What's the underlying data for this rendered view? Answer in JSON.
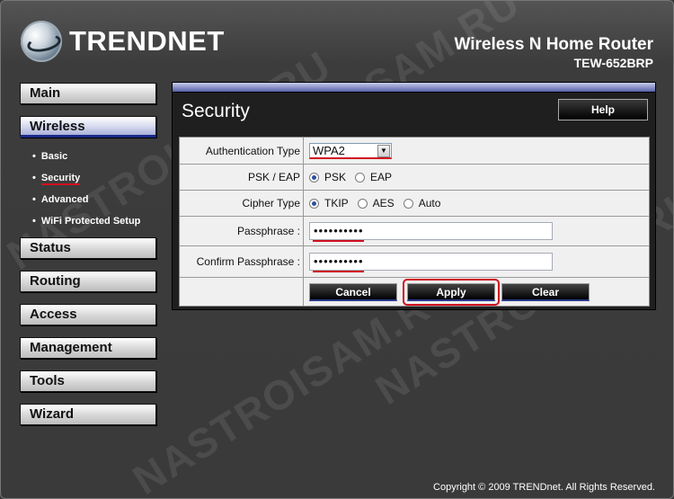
{
  "header": {
    "logo_text": "TRENDNET",
    "product_name": "Wireless N Home Router",
    "model": "TEW-652BRP"
  },
  "nav": {
    "items": [
      {
        "label": "Main"
      },
      {
        "label": "Wireless"
      },
      {
        "label": "Status"
      },
      {
        "label": "Routing"
      },
      {
        "label": "Access"
      },
      {
        "label": "Management"
      },
      {
        "label": "Tools"
      },
      {
        "label": "Wizard"
      }
    ],
    "wireless_sub": [
      {
        "label": "Basic"
      },
      {
        "label": "Security"
      },
      {
        "label": "Advanced"
      },
      {
        "label": "WiFi Protected Setup"
      }
    ],
    "bullet": "•"
  },
  "panel": {
    "title": "Security",
    "help_label": "Help"
  },
  "form": {
    "auth_label": "Authentication Type",
    "auth_value": "WPA2",
    "psk_eap_label": "PSK / EAP",
    "psk_label": "PSK",
    "eap_label": "EAP",
    "cipher_label": "Cipher Type",
    "tkip_label": "TKIP",
    "aes_label": "AES",
    "auto_label": "Auto",
    "passphrase_label": "Passphrase :",
    "passphrase_value": "••••••••••",
    "confirm_label": "Confirm Passphrase :",
    "confirm_value": "••••••••••"
  },
  "buttons": {
    "cancel": "Cancel",
    "apply": "Apply",
    "clear": "Clear"
  },
  "watermark": "NASTROISAM.RU",
  "footer": "Copyright © 2009 TRENDnet. All Rights Reserved."
}
